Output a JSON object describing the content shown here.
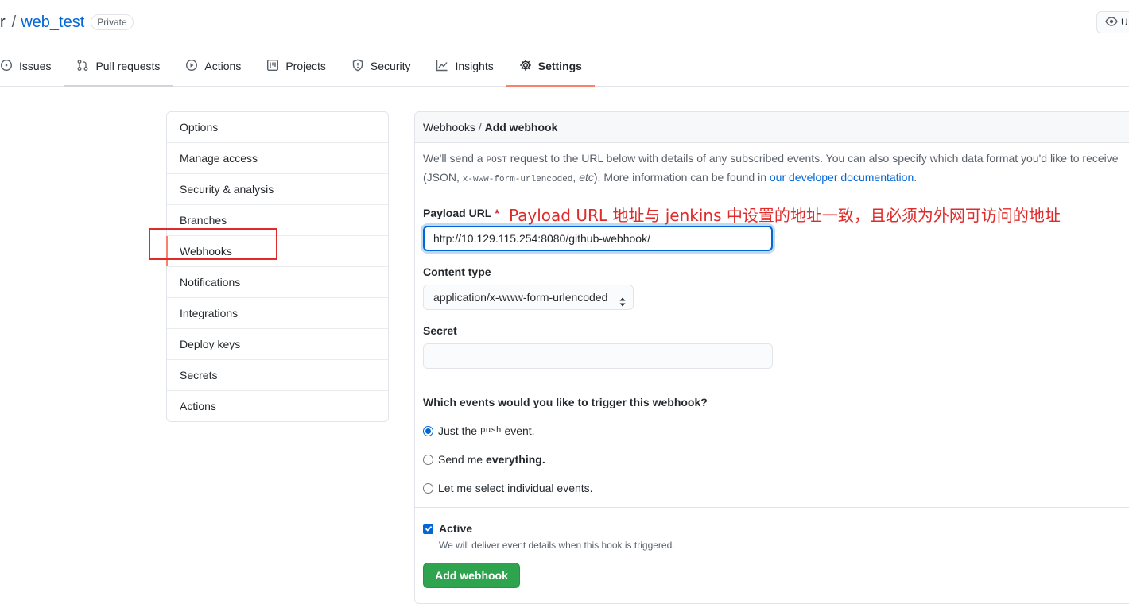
{
  "repo": {
    "owner_sep": "r",
    "slash": "/",
    "name": "web_test",
    "visibility": "Private",
    "watch_label": "U"
  },
  "tabs": [
    {
      "label": "Issues",
      "icon": "issue-icon"
    },
    {
      "label": "Pull requests",
      "icon": "pull-request-icon"
    },
    {
      "label": "Actions",
      "icon": "play-icon"
    },
    {
      "label": "Projects",
      "icon": "project-icon"
    },
    {
      "label": "Security",
      "icon": "shield-icon"
    },
    {
      "label": "Insights",
      "icon": "graph-icon"
    },
    {
      "label": "Settings",
      "icon": "gear-icon",
      "active": true
    }
  ],
  "sidebar": {
    "items": [
      {
        "label": "Options"
      },
      {
        "label": "Manage access"
      },
      {
        "label": "Security & analysis"
      },
      {
        "label": "Branches"
      },
      {
        "label": "Webhooks",
        "selected": true
      },
      {
        "label": "Notifications"
      },
      {
        "label": "Integrations"
      },
      {
        "label": "Deploy keys"
      },
      {
        "label": "Secrets"
      },
      {
        "label": "Actions"
      }
    ]
  },
  "breadcrumb": {
    "parent": "Webhooks",
    "sep": "/",
    "current": "Add webhook"
  },
  "description": {
    "part1": "We'll send a ",
    "post": "POST",
    "part2": " request to the URL below with details of any subscribed events. You can also specify which data format you'd like to receive (JSON, ",
    "urlenc": "x-www-form-urlencoded",
    "part3": ", ",
    "etc": "etc",
    "part4": "). More information can be found in ",
    "link": "our developer documentation",
    "part5": "."
  },
  "form": {
    "payload_label": "Payload URL",
    "required_mark": "*",
    "annotation": "Payload URL 地址与 jenkins 中设置的地址一致，且必须为外网可访问的地址",
    "payload_value": "http://10.129.115.254:8080/github-webhook/",
    "content_type_label": "Content type",
    "content_type_value": "application/x-www-form-urlencoded",
    "secret_label": "Secret",
    "secret_value": "",
    "events_question": "Which events would you like to trigger this webhook?",
    "events": {
      "push_pre": "Just the",
      "push_code": "push",
      "push_post": "event.",
      "all_pre": "Send me",
      "all_bold": "everything.",
      "select": "Let me select individual events."
    },
    "selected_event": "push",
    "active_label": "Active",
    "active_checked": true,
    "active_note": "We will deliver event details when this hook is triggered.",
    "submit_label": "Add webhook"
  },
  "colors": {
    "link": "#0366d6",
    "active_tab_underline": "#f9826c",
    "annotation_red": "#e02b2b",
    "primary_button": "#2ea44f"
  }
}
